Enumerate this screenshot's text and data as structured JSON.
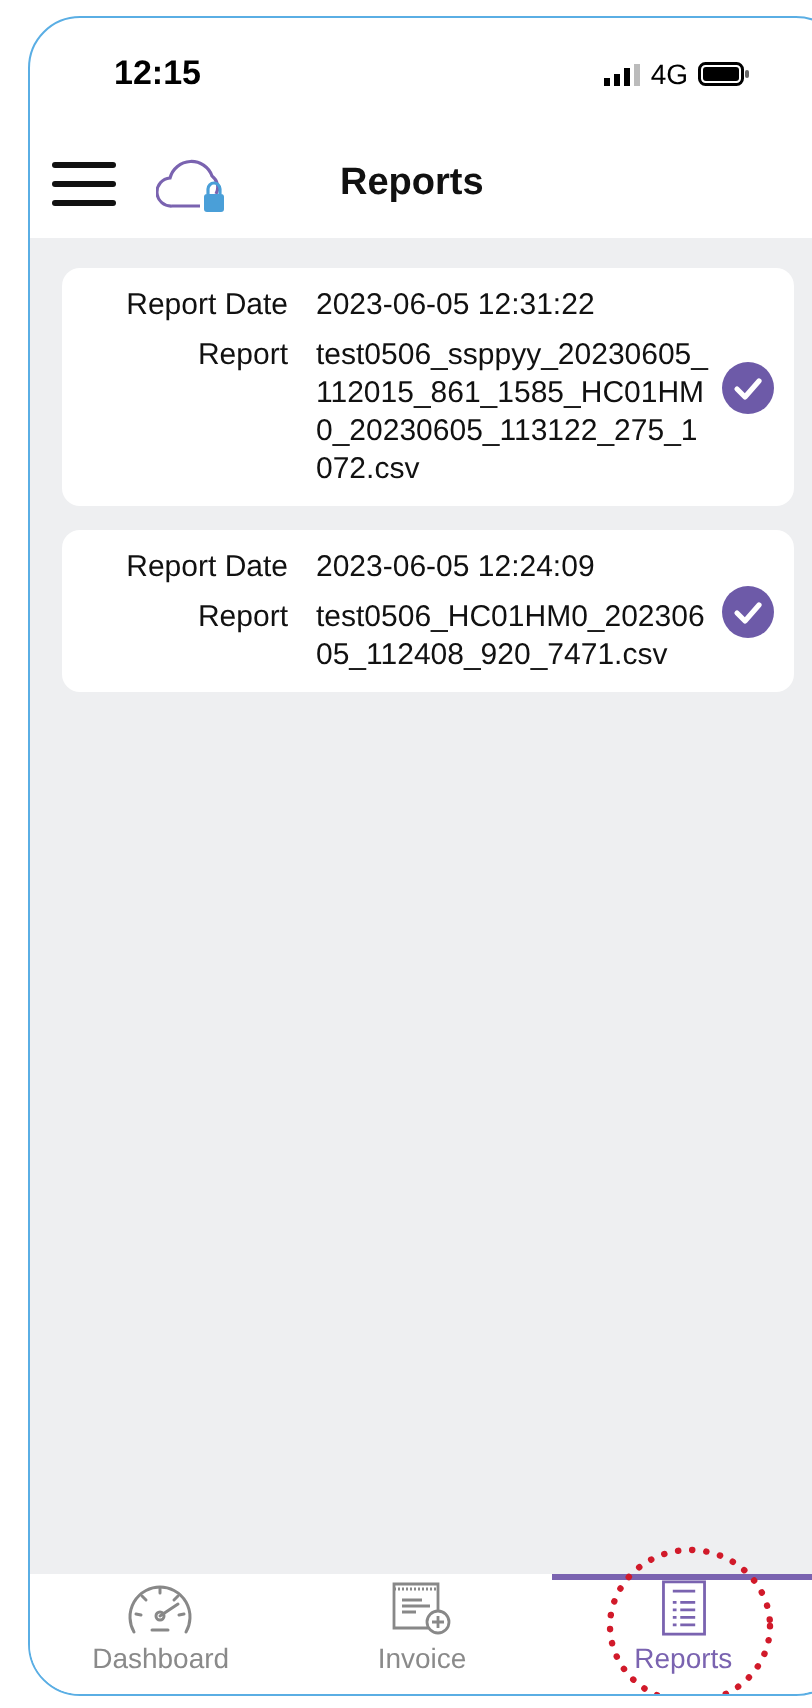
{
  "status_bar": {
    "time": "12:15",
    "network": "4G"
  },
  "header": {
    "title": "Reports"
  },
  "reports": [
    {
      "date_label": "Report Date",
      "date": "2023-06-05 12:31:22",
      "file_label": "Report",
      "file": "test0506_ssppyy_20230605_112015_861_1585_HC01HM0_20230605_113122_275_1072.csv",
      "checked": true
    },
    {
      "date_label": "Report Date",
      "date": "2023-06-05 12:24:09",
      "file_label": "Report",
      "file": "test0506_HC01HM0_20230605_112408_920_7471.csv",
      "checked": true
    }
  ],
  "tabs": [
    {
      "kind": "dashboard",
      "label": "Dashboard",
      "selected": false
    },
    {
      "kind": "invoice",
      "label": "Invoice",
      "selected": false
    },
    {
      "kind": "reports",
      "label": "Reports",
      "selected": true
    }
  ]
}
